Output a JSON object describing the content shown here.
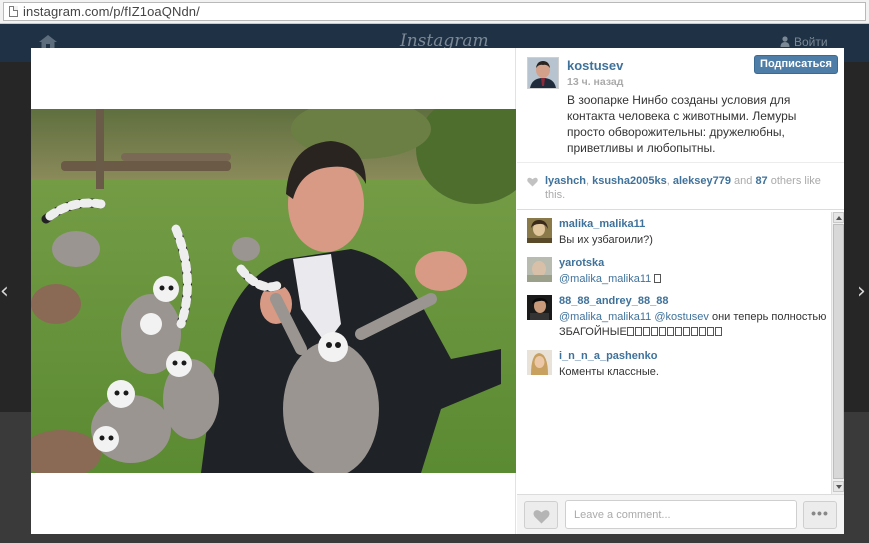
{
  "browser": {
    "url": "instagram.com/p/fIZ1oaQNdn/"
  },
  "site": {
    "logo": "Instagram",
    "login_label": "Войти"
  },
  "nav": {
    "prev_symbol": "‹",
    "next_symbol": "›"
  },
  "post": {
    "username": "kostusev",
    "time_ago": "13 ч. назад",
    "follow_label": "Подписаться",
    "caption": "В зоопарке Нинбо созданы условия для контакта человека с животными. Лемуры просто обворожительны: дружелюбны, приветливы и любопытны."
  },
  "likes": {
    "users": [
      "lyashch",
      "ksusha2005ks",
      "aleksey779"
    ],
    "separator": ", ",
    "and_text": " and ",
    "others_count": "87",
    "others_text": " others like this."
  },
  "comments": [
    {
      "user": "malika_malika11",
      "text": "Вы их узбагоили?)"
    },
    {
      "user": "yarotska",
      "mention": "@malika_malika11",
      "text": ""
    },
    {
      "user": "88_88_andrey_88_88",
      "mention": "@malika_malika11",
      "mention2": "@kostusev",
      "text": " они теперь полностью ЗБАГОЙНЫЕ"
    },
    {
      "user": "i_n_n_a_pashenko",
      "text": "Коменты классные."
    }
  ],
  "footer": {
    "comment_placeholder": "Leave a comment...",
    "more_label": "•••"
  },
  "colors": {
    "link_blue": "#3f729b",
    "follow_button": "#4e7ea7",
    "header_bg": "#1f3144"
  },
  "icons": [
    "page-icon",
    "home-icon",
    "user-icon",
    "heart-icon",
    "more-icon"
  ]
}
